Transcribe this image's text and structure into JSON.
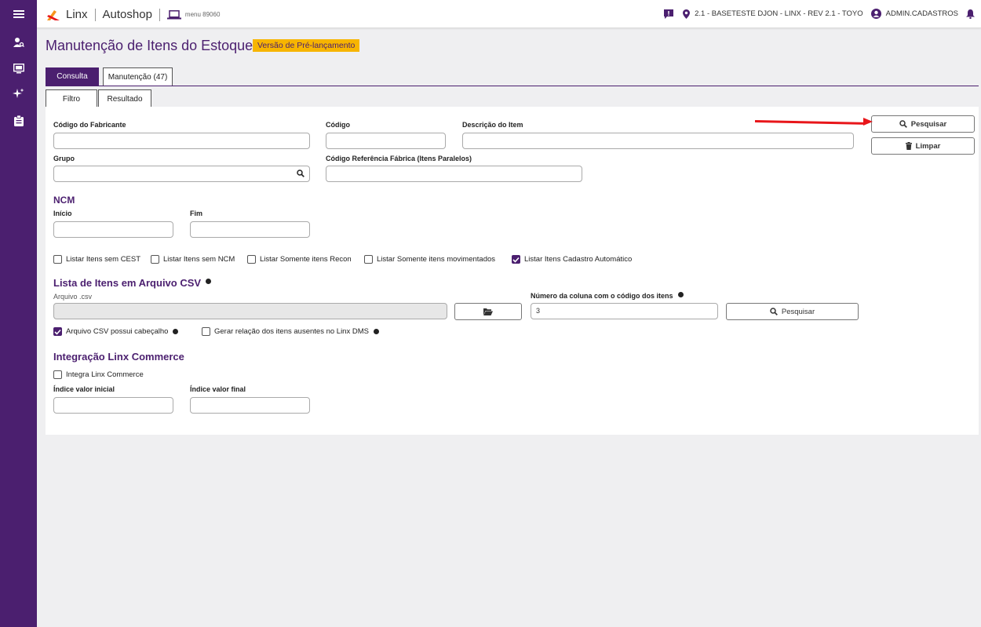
{
  "topbar": {
    "brand": "Linx",
    "product": "Autoshop",
    "menu": "menu 89060",
    "location": "2.1 - BASETESTE DJON - LINX - REV 2.1 - TOYO",
    "user": "ADMIN.CADASTROS"
  },
  "sidebar": {
    "items": [
      "menu-icon",
      "user-search-icon",
      "monitor-icon",
      "sparkle-icon",
      "clipboard-icon"
    ]
  },
  "page": {
    "title": "Manutenção de Itens do Estoque",
    "badge": "Versão de Pré-lançamento"
  },
  "tabs": {
    "main": [
      "Consulta",
      "Manutenção (47)"
    ],
    "sub": [
      "Filtro",
      "Resultado"
    ]
  },
  "filter": {
    "fabricante_label": "Código do Fabricante",
    "codigo_label": "Código",
    "descricao_label": "Descrição do Item",
    "grupo_label": "Grupo",
    "ref_fabrica_label": "Código Referência Fábrica (Itens Paralelos)",
    "ncm_title": "NCM",
    "inicio_label": "Início",
    "fim_label": "Fim"
  },
  "buttons": {
    "pesquisar": "Pesquisar",
    "limpar": "Limpar",
    "csv_pesquisar": "Pesquisar"
  },
  "checkboxes": [
    {
      "label": "Listar Itens sem CEST",
      "checked": false
    },
    {
      "label": "Listar Itens sem NCM",
      "checked": false
    },
    {
      "label": "Listar Somente itens Recon",
      "checked": false
    },
    {
      "label": "Listar Somente itens movimentados",
      "checked": false
    },
    {
      "label": "Listar Itens Cadastro Automático",
      "checked": true
    }
  ],
  "csv": {
    "title": "Lista de Itens em Arquivo CSV",
    "file_label": "Arquivo .csv",
    "column_label": "Número da coluna com o código dos itens",
    "column_value": "3",
    "header_label": "Arquivo CSV possui cabeçalho",
    "header_checked": true,
    "missing_label": "Gerar relação dos itens ausentes no Linx DMS",
    "missing_checked": false
  },
  "commerce": {
    "title": "Integração Linx Commerce",
    "integra_label": "Integra Linx Commerce",
    "integra_checked": false,
    "inicial_label": "Índice valor inicial",
    "final_label": "Índice valor final"
  },
  "colors": {
    "primary": "#4b1f6f",
    "badge": "#f7b500",
    "arrow": "#e8161a"
  }
}
